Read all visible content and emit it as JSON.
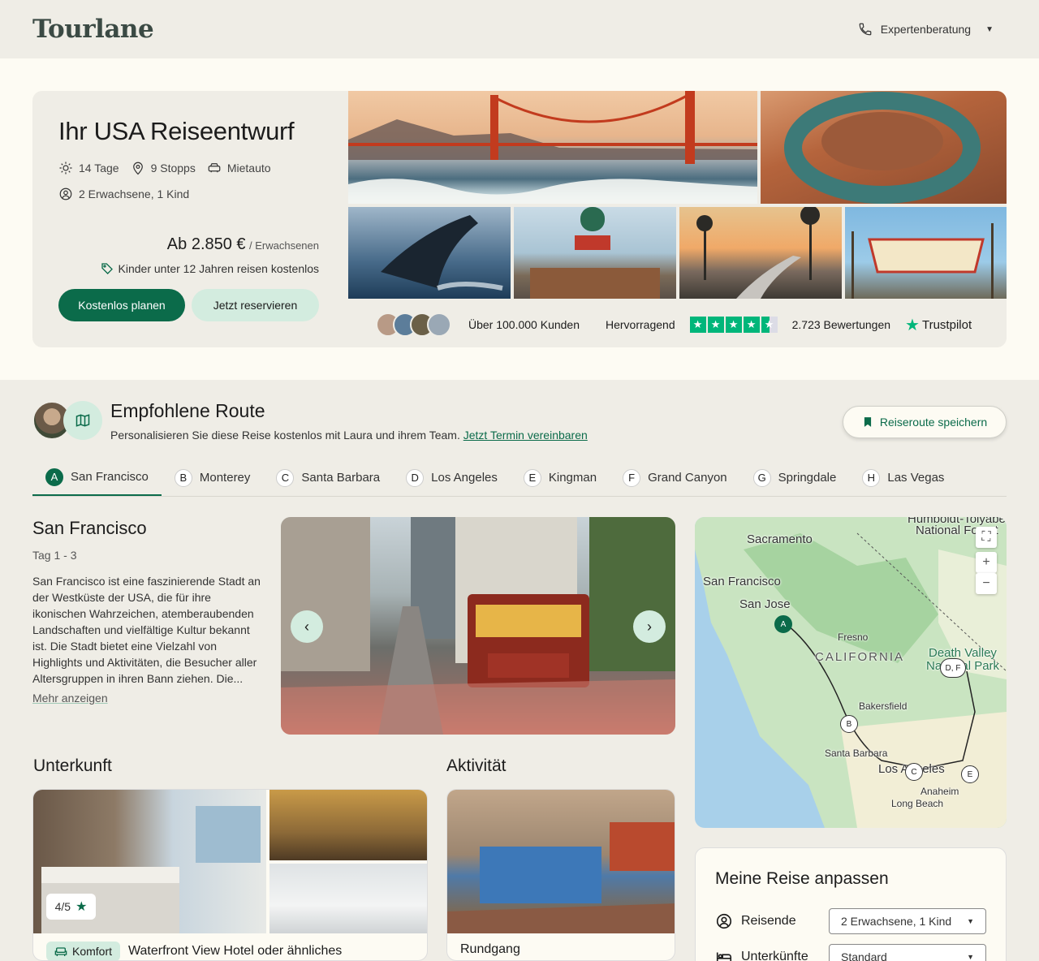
{
  "header": {
    "logo": "Tourlane",
    "expert_label": "Expertenberatung"
  },
  "hero": {
    "title": "Ihr USA Reiseentwurf",
    "days": "14 Tage",
    "stops": "9 Stopps",
    "transport": "Mietauto",
    "travelers": "2 Erwachsene, 1 Kind",
    "price": "Ab 2.850 €",
    "price_unit": "/ Erwachsenen",
    "kids_note": "Kinder unter 12 Jahren reisen kostenlos",
    "btn_primary": "Kostenlos planen",
    "btn_secondary": "Jetzt reservieren"
  },
  "trust": {
    "customers": "Über 100.000 Kunden",
    "rating_word": "Hervorragend",
    "stars": 4.5,
    "reviews": "2.723 Bewertungen",
    "brand": "Trustpilot"
  },
  "route": {
    "title": "Empfohlene Route",
    "subtitle": "Personalisieren Sie diese Reise kostenlos mit Laura und ihrem Team.",
    "link": "Jetzt Termin vereinbaren",
    "save": "Reiseroute speichern",
    "tabs": [
      {
        "badge": "A",
        "label": "San Francisco"
      },
      {
        "badge": "B",
        "label": "Monterey"
      },
      {
        "badge": "C",
        "label": "Santa Barbara"
      },
      {
        "badge": "D",
        "label": "Los Angeles"
      },
      {
        "badge": "E",
        "label": "Kingman"
      },
      {
        "badge": "F",
        "label": "Grand Canyon"
      },
      {
        "badge": "G",
        "label": "Springdale"
      },
      {
        "badge": "H",
        "label": "Las Vegas"
      }
    ]
  },
  "city": {
    "name": "San Francisco",
    "days": "Tag 1 - 3",
    "desc": "San Francisco ist eine faszinierende Stadt an der Westküste der USA, die für ihre ikonischen Wahrzeichen, atemberaubenden Landschaften und vielfältige Kultur bekannt ist. Die Stadt bietet eine Vielzahl von Highlights und Aktivitäten, die Besucher aller Altersgruppen in ihren Bann ziehen. Die...",
    "more": "Mehr anzeigen"
  },
  "map": {
    "labels": {
      "sacramento": "Sacramento",
      "sf": "San Francisco",
      "sj": "San Jose",
      "fresno": "Fresno",
      "california": "CALIFORNIA",
      "death_valley": "Death Valley",
      "np": "National Park",
      "bakersfield": "Bakersfield",
      "santa_barbara": "Santa Barbara",
      "la": "Los Angeles",
      "anaheim": "Anaheim",
      "long_beach": "Long Beach",
      "humboldt": "Humboldt-Toiyabe",
      "humboldt2": "National Forest"
    },
    "pins": {
      "a": "A",
      "b": "B",
      "c": "C",
      "df": "D, F",
      "e": "E"
    }
  },
  "unterkunft": {
    "title": "Unterkunft",
    "rating": "4/5",
    "tier": "Komfort",
    "hotel": "Waterfront View Hotel oder ähnliches"
  },
  "aktivitaet": {
    "title": "Aktivität",
    "name": "Rundgang"
  },
  "adjust": {
    "title": "Meine Reise anpassen",
    "travelers_label": "Reisende",
    "travelers_value": "2 Erwachsene, 1 Kind",
    "accom_label": "Unterkünfte",
    "accom_value": "Standard"
  }
}
